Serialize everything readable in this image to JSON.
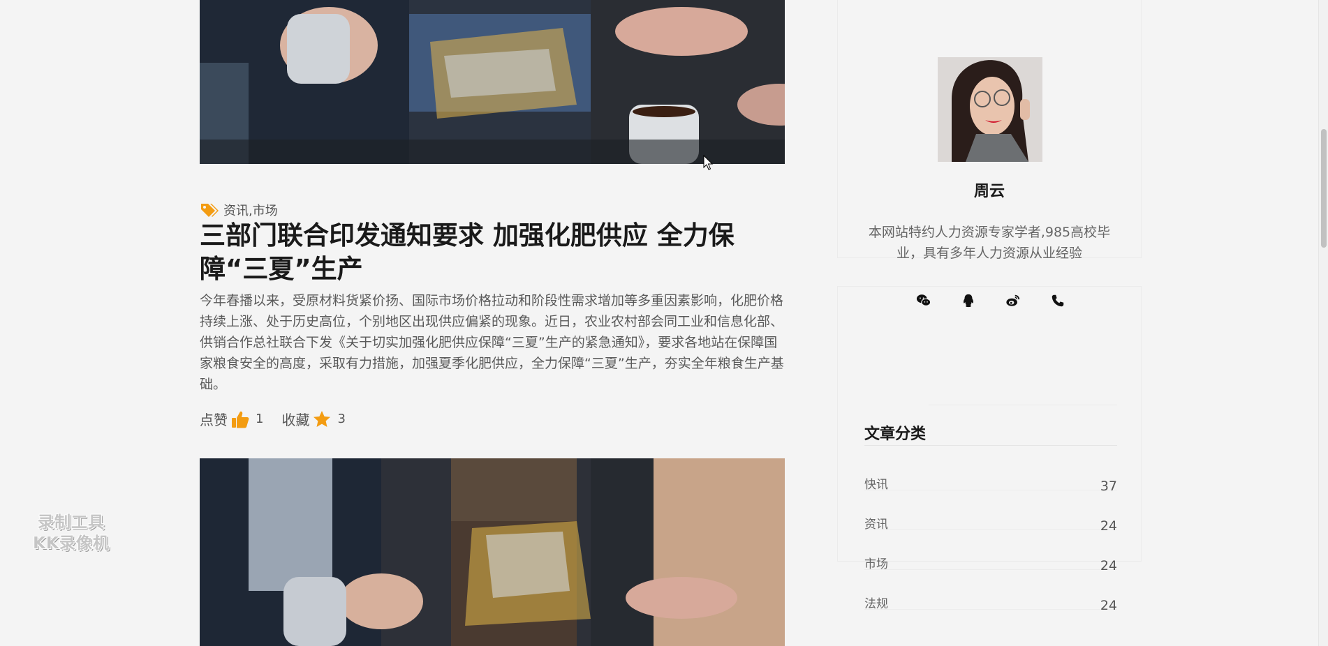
{
  "post": {
    "tags": "资讯,市场",
    "title": "三部门联合印发通知要求 加强化肥供应 全力保障“三夏”生产",
    "excerpt": "今年春播以来，受原材料货紧价扬、国际市场价格拉动和阶段性需求增加等多重因素影响，化肥价格持续上涨、处于历史高位，个别地区出现供应偏紧的现象。近日，农业农村部会同工业和信息化部、供销合作总社联合下发《关于切实加强化肥供应保障“三夏”生产的紧急通知》，要求各地站在保障国家粮食安全的高度，采取有力措施，加强夏季化肥供应，全力保障“三夏”生产，夯实全年粮食生产基础。",
    "like_label": "点赞",
    "like_count": "1",
    "fav_label": "收藏",
    "fav_count": "3"
  },
  "profile": {
    "name": "周云",
    "bio": "本网站特约人力资源专家学者,985高校毕业，具有多年人力资源从业经验"
  },
  "social": {
    "icons": [
      "wechat-icon",
      "qq-icon",
      "weibo-icon",
      "phone-icon"
    ]
  },
  "categories": {
    "title": "文章分类",
    "items": [
      {
        "name": "快讯",
        "count": "37"
      },
      {
        "name": "资讯",
        "count": "24"
      },
      {
        "name": "市场",
        "count": "24"
      },
      {
        "name": "法规",
        "count": "24"
      }
    ]
  },
  "watermark": {
    "line1": "录制工具",
    "line2": "KK录像机"
  },
  "colors": {
    "accent": "#f39c12",
    "background": "#f4f4f4",
    "title": "#1a1a1a"
  }
}
